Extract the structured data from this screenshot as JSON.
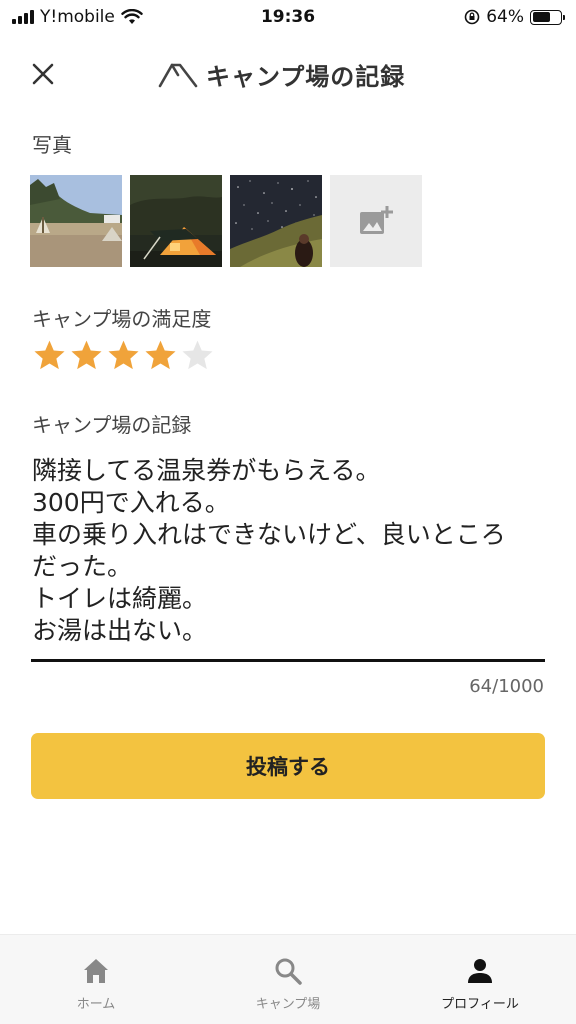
{
  "status_bar": {
    "carrier": "Y!mobile",
    "time": "19:36",
    "battery": "64%",
    "battery_level": 0.64
  },
  "header": {
    "title": "キャンプ場の記録",
    "close_icon": "close-icon",
    "logo_icon": "tent-logo-icon"
  },
  "photos": {
    "label": "写真",
    "items": [
      "photo-campsite-day",
      "photo-tent-night",
      "photo-starry-sky"
    ],
    "add_icon": "add-photo-icon"
  },
  "satisfaction": {
    "label": "キャンプ場の満足度",
    "rating": 4,
    "max": 5,
    "star_color": "#f0a33a",
    "empty_color": "#e6e6e6"
  },
  "record": {
    "label": "キャンプ場の記録",
    "lines": [
      "隣接してる温泉券がもらえる。",
      "300円で入れる。",
      "車の乗り入れはできないけど、良いところ",
      "だった。",
      "トイレは綺麗。",
      "お湯は出ない。"
    ],
    "count": "64/1000"
  },
  "submit": {
    "label": "投稿する",
    "color": "#f3c340"
  },
  "tabs": [
    {
      "label": "ホーム",
      "icon": "home-icon",
      "active": false
    },
    {
      "label": "キャンプ場",
      "icon": "search-icon",
      "active": false
    },
    {
      "label": "プロフィール",
      "icon": "profile-icon",
      "active": true
    }
  ]
}
